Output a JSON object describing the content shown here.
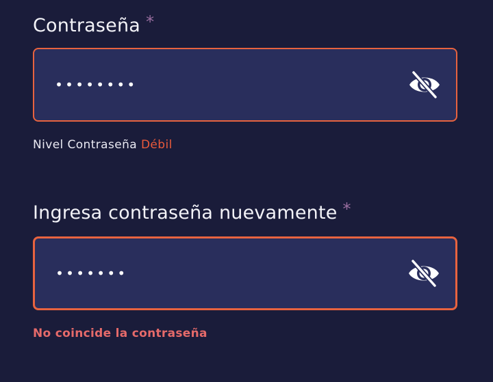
{
  "password": {
    "label": "Contraseña",
    "required_mark": "*",
    "value": "••••••••",
    "toggle_icon": "eye-off-icon",
    "strength_label": "Nivel Contraseña",
    "strength_value": "Débil"
  },
  "confirm": {
    "label": "Ingresa contraseña nuevamente",
    "required_mark": "*",
    "value": "•••••••",
    "toggle_icon": "eye-off-icon",
    "error": "No coincide la contraseña"
  },
  "colors": {
    "background": "#1a1c3a",
    "field_bg": "#292e5c",
    "border_error": "#e8633f",
    "weak": "#ea5a3b",
    "error_text": "#e56a6a",
    "required": "#9a6ea0"
  }
}
